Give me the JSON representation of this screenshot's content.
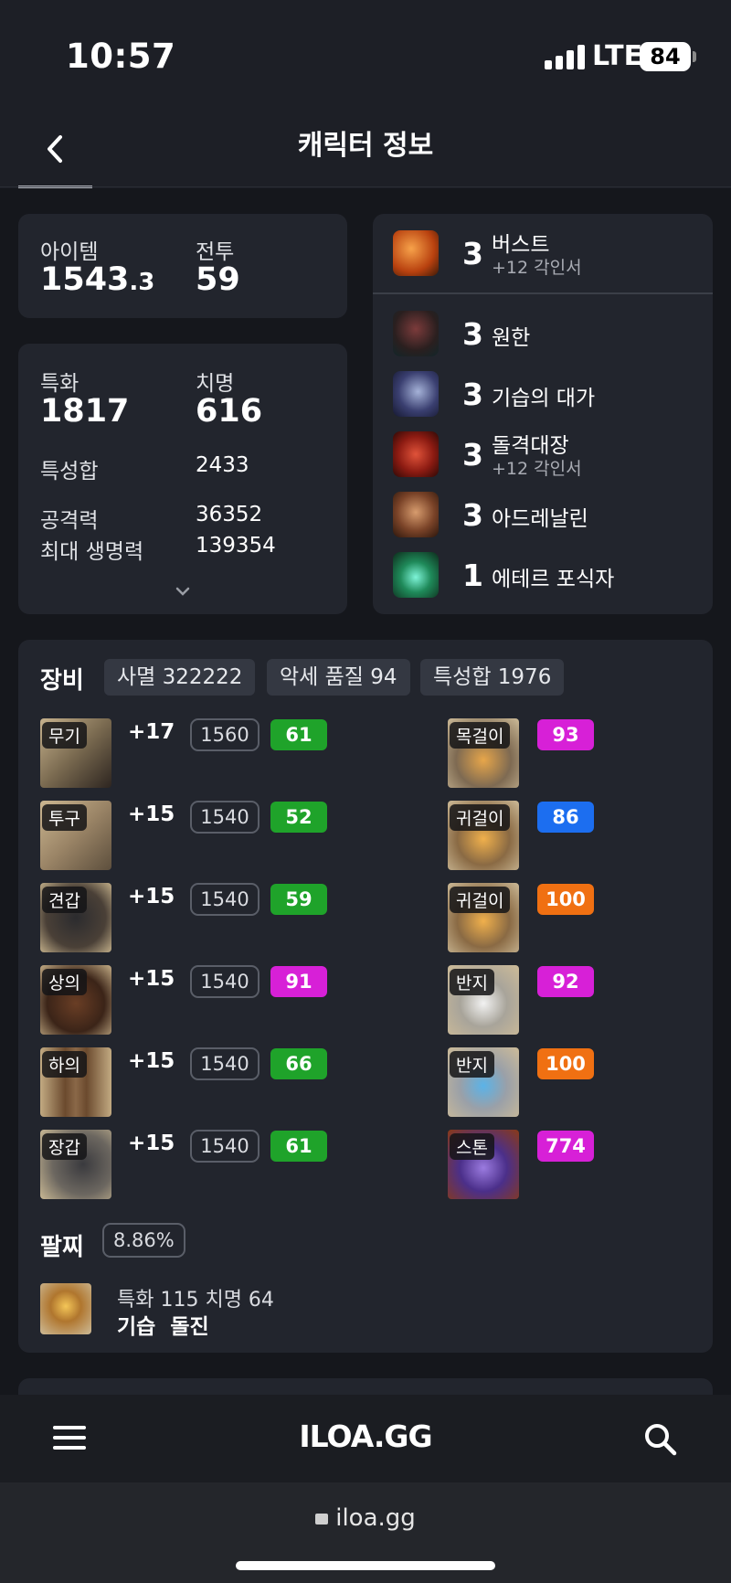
{
  "status_bar": {
    "time": "10:57",
    "network": "LTE",
    "battery": "84"
  },
  "header": {
    "title": "캐릭터 정보"
  },
  "summary": {
    "item_label": "아이템",
    "item_value_main": "1543",
    "item_value_dec": ".3",
    "combat_label": "전투",
    "combat_value": "59"
  },
  "stats": {
    "spec_label": "특화",
    "spec_value": "1817",
    "crit_label": "치명",
    "crit_value": "616",
    "trait_sum_label": "특성합",
    "trait_sum_value": "2433",
    "attack_label": "공격력",
    "attack_value": "36352",
    "max_hp_label": "최대 생명력",
    "max_hp_value": "139354"
  },
  "engravings": [
    {
      "level": "3",
      "name": "버스트",
      "sub": "+12 각인서",
      "icon": "burst-icon"
    },
    {
      "level": "3",
      "name": "원한",
      "sub": "",
      "icon": "grudge-icon"
    },
    {
      "level": "3",
      "name": "기습의 대가",
      "sub": "",
      "icon": "ambush-icon"
    },
    {
      "level": "3",
      "name": "돌격대장",
      "sub": "+12 각인서",
      "icon": "raid-captain-icon"
    },
    {
      "level": "3",
      "name": "아드레날린",
      "sub": "",
      "icon": "adrenaline-icon"
    },
    {
      "level": "1",
      "name": "에테르 포식자",
      "sub": "",
      "icon": "ether-predator-icon"
    }
  ],
  "equipment": {
    "title": "장비",
    "chips": [
      "사멸 322222",
      "악세 품질 94",
      "특성합 1976"
    ],
    "gear": [
      {
        "tag": "무기",
        "plus": "+17",
        "ilvl": "1560",
        "quality": "61",
        "color": "#1fa32a"
      },
      {
        "tag": "투구",
        "plus": "+15",
        "ilvl": "1540",
        "quality": "52",
        "color": "#1fa32a"
      },
      {
        "tag": "견갑",
        "plus": "+15",
        "ilvl": "1540",
        "quality": "59",
        "color": "#1fa32a"
      },
      {
        "tag": "상의",
        "plus": "+15",
        "ilvl": "1540",
        "quality": "91",
        "color": "#d720d7"
      },
      {
        "tag": "하의",
        "plus": "+15",
        "ilvl": "1540",
        "quality": "66",
        "color": "#1fa32a"
      },
      {
        "tag": "장갑",
        "plus": "+15",
        "ilvl": "1540",
        "quality": "61",
        "color": "#1fa32a"
      }
    ],
    "accessories": [
      {
        "tag": "목걸이",
        "quality": "93",
        "color": "#d720d7"
      },
      {
        "tag": "귀걸이",
        "quality": "86",
        "color": "#1c6ef0"
      },
      {
        "tag": "귀걸이",
        "quality": "100",
        "color": "#f07012"
      },
      {
        "tag": "반지",
        "quality": "92",
        "color": "#d720d7"
      },
      {
        "tag": "반지",
        "quality": "100",
        "color": "#f07012"
      },
      {
        "tag": "스톤",
        "quality": "774",
        "color": "#d720d7"
      }
    ]
  },
  "bracelet": {
    "title": "팔찌",
    "percent": "8.86%",
    "stats": "특화 115  치명 64",
    "effects": "기습  돌진"
  },
  "bottom_nav": {
    "logo": "ILOA.GG"
  },
  "url_bar": {
    "url": "iloa.gg"
  }
}
